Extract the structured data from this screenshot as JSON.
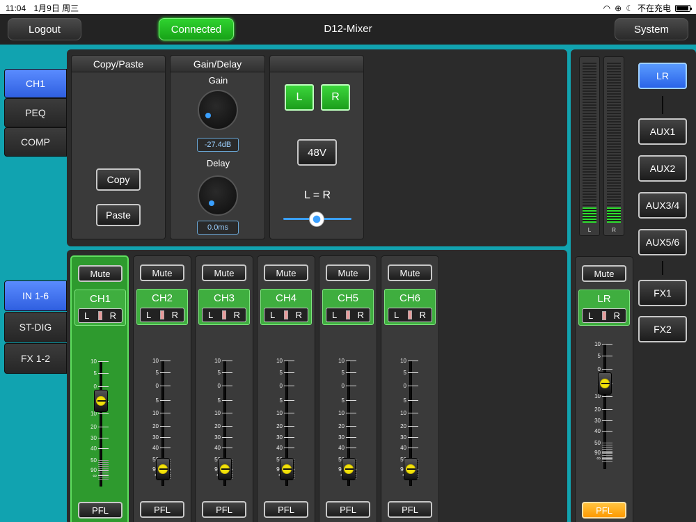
{
  "status_bar": {
    "time": "11:04",
    "date": "1月9日 周三",
    "charging": "不在充电"
  },
  "header": {
    "logout": "Logout",
    "connected": "Connected",
    "title": "D12-Mixer",
    "system": "System"
  },
  "left_tabs_top": [
    {
      "label": "CH1",
      "active": true
    },
    {
      "label": "PEQ",
      "active": false
    },
    {
      "label": "COMP",
      "active": false
    }
  ],
  "left_tabs_bottom": [
    {
      "label": "IN 1-6",
      "active": true
    },
    {
      "label": "ST-DIG",
      "active": false
    },
    {
      "label": "FX 1-2",
      "active": false
    }
  ],
  "copy_paste": {
    "title": "Copy/Paste",
    "copy": "Copy",
    "paste": "Paste"
  },
  "gain_delay": {
    "title": "Gain/Delay",
    "gain_label": "Gain",
    "gain_value": "-27.4dB",
    "delay_label": "Delay",
    "delay_value": "0.0ms"
  },
  "stereo": {
    "l": "L",
    "r": "R",
    "phantom": "48V",
    "link_label": "L = R",
    "slider_value": 0.5
  },
  "channels": [
    {
      "name": "CH1",
      "mute": "Mute",
      "pfl": "PFL",
      "pan_l": "L",
      "pan_r": "R",
      "level_db": 5,
      "selected": true
    },
    {
      "name": "CH2",
      "mute": "Mute",
      "pfl": "PFL",
      "pan_l": "L",
      "pan_r": "R",
      "level_db": -90,
      "selected": false
    },
    {
      "name": "CH3",
      "mute": "Mute",
      "pfl": "PFL",
      "pan_l": "L",
      "pan_r": "R",
      "level_db": -90,
      "selected": false
    },
    {
      "name": "CH4",
      "mute": "Mute",
      "pfl": "PFL",
      "pan_l": "L",
      "pan_r": "R",
      "level_db": -90,
      "selected": false
    },
    {
      "name": "CH5",
      "mute": "Mute",
      "pfl": "PFL",
      "pan_l": "L",
      "pan_r": "R",
      "level_db": -90,
      "selected": false
    },
    {
      "name": "CH6",
      "mute": "Mute",
      "pfl": "PFL",
      "pan_l": "L",
      "pan_r": "R",
      "level_db": -90,
      "selected": false
    }
  ],
  "fader_scale": [
    "10",
    "5",
    "0",
    "5",
    "10",
    "20",
    "30",
    "40",
    "50",
    "90",
    "∞"
  ],
  "master": {
    "name": "LR",
    "mute": "Mute",
    "pfl": "PFL",
    "pan_l": "L",
    "pan_r": "R",
    "level_db": 5
  },
  "meters": [
    {
      "label": "L",
      "level": 0.1
    },
    {
      "label": "R",
      "level": 0.1
    }
  ],
  "buses": [
    {
      "label": "LR",
      "active": true
    },
    {
      "label": "AUX1",
      "active": false
    },
    {
      "label": "AUX2",
      "active": false
    },
    {
      "label": "AUX3/4",
      "active": false
    },
    {
      "label": "AUX5/6",
      "active": false
    },
    {
      "label": "FX1",
      "active": false
    },
    {
      "label": "FX2",
      "active": false
    }
  ],
  "colors": {
    "accent_blue": "#2f5fe0",
    "accent_green": "#2ee02e",
    "background": "#11a3b0",
    "pfl_orange": "#ff9a00"
  }
}
